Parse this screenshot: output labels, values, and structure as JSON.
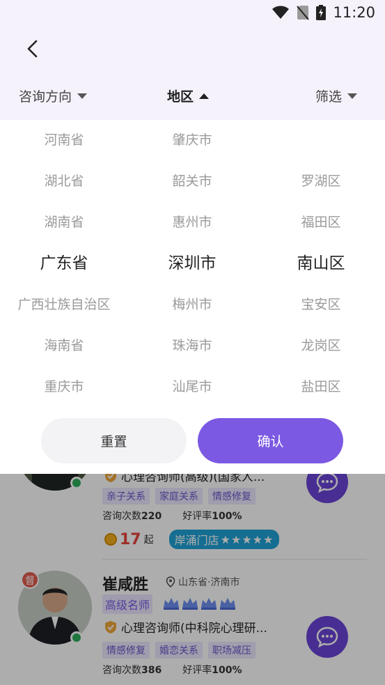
{
  "status_bar": {
    "time": "11:20",
    "icons": [
      "wifi-icon",
      "no-sim-icon",
      "battery-charging-icon"
    ]
  },
  "filter_tabs": [
    {
      "label": "咨询方向",
      "state": "collapsed"
    },
    {
      "label": "地区",
      "state": "expanded"
    },
    {
      "label": "筛选",
      "state": "collapsed"
    }
  ],
  "picker": {
    "provinces": [
      "河南省",
      "湖北省",
      "湖南省",
      "广东省",
      "广西壮族自治区",
      "海南省",
      "重庆市"
    ],
    "cities": [
      "肇庆市",
      "韶关市",
      "惠州市",
      "深圳市",
      "梅州市",
      "珠海市",
      "汕尾市"
    ],
    "districts": [
      "",
      "罗湖区",
      "福田区",
      "南山区",
      "宝安区",
      "龙岗区",
      "盐田区"
    ],
    "selected_index": 3
  },
  "actions": {
    "reset_label": "重置",
    "confirm_label": "确认"
  },
  "list": [
    {
      "certification": "心理咨询师(高级)(国家人...",
      "tags": [
        "亲子关系",
        "家庭关系",
        "情感修复"
      ],
      "consult_label": "咨询次数",
      "consult_count": "220",
      "rating_label": "好评率",
      "rating": "100%",
      "price": "17",
      "price_unit": "起",
      "store": "岸涌门店",
      "stars": "★★★★★"
    },
    {
      "supervisor_badge": "督",
      "name": "崔咸胜",
      "location": "山东省·济南市",
      "title": "高级名师",
      "crown_count": 4,
      "certification": "心理咨询师(中科院心理研...",
      "tags": [
        "情感修复",
        "婚恋关系",
        "职场减压"
      ],
      "consult_label": "咨询次数",
      "consult_count": "386",
      "rating_label": "好评率",
      "rating": "100%"
    }
  ],
  "colors": {
    "accent": "#7b59e3",
    "tag_text": "#6b57c9",
    "price": "#e8453c",
    "store_badge": "#1fa3d6",
    "online": "#2eae5a"
  }
}
